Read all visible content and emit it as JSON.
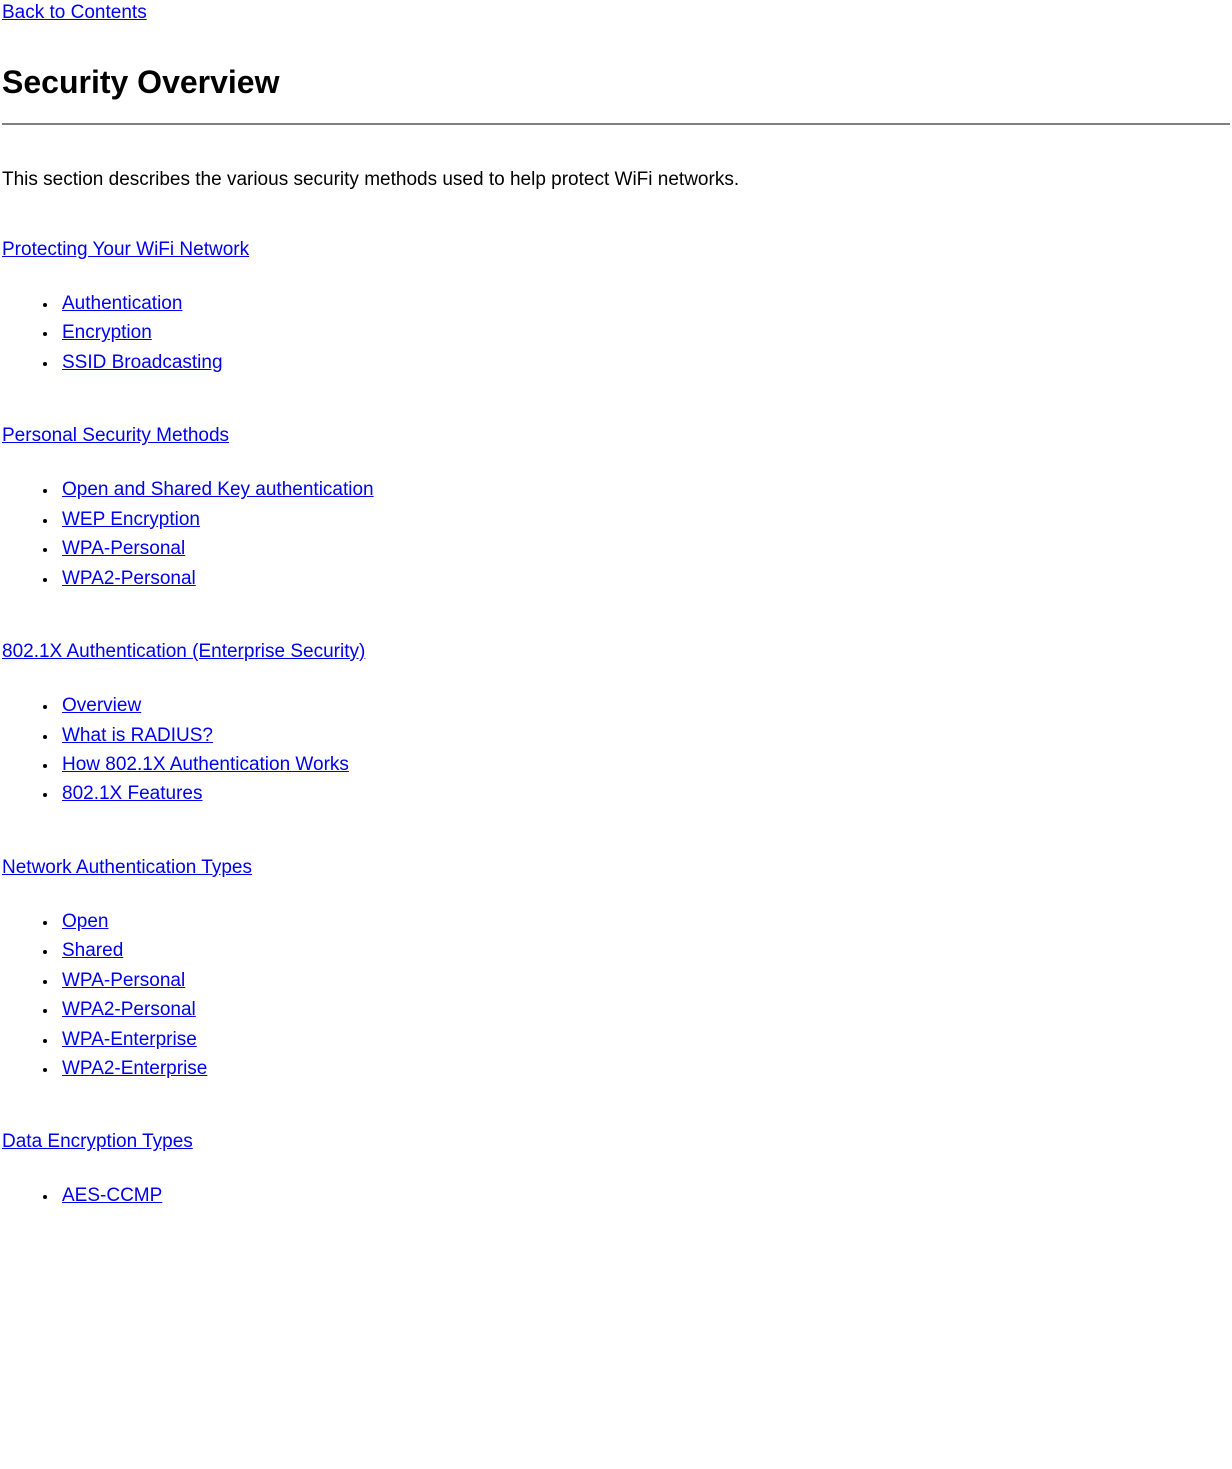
{
  "top_link": "Back to Contents",
  "title": "Security Overview",
  "intro": "This section describes the various security methods used to help protect WiFi networks.",
  "sections": [
    {
      "heading": "Protecting Your WiFi Network",
      "items": [
        "Authentication",
        "Encryption",
        "SSID Broadcasting"
      ]
    },
    {
      "heading": "Personal Security Methods ",
      "items": [
        "Open and Shared Key authentication",
        "WEP Encryption",
        "WPA-Personal",
        "WPA2-Personal"
      ]
    },
    {
      "heading": "802.1X Authentication (Enterprise Security) ",
      "items": [
        "Overview",
        "What is RADIUS?",
        "How 802.1X Authentication Works",
        "802.1X Features"
      ]
    },
    {
      "heading": "Network Authentication Types ",
      "items": [
        "Open",
        "Shared",
        "WPA-Personal ",
        "WPA2-Personal ",
        "WPA-Enterprise",
        "WPA2-Enterprise"
      ]
    },
    {
      "heading": "Data Encryption Types ",
      "items": [
        "AES-CCMP"
      ]
    }
  ]
}
